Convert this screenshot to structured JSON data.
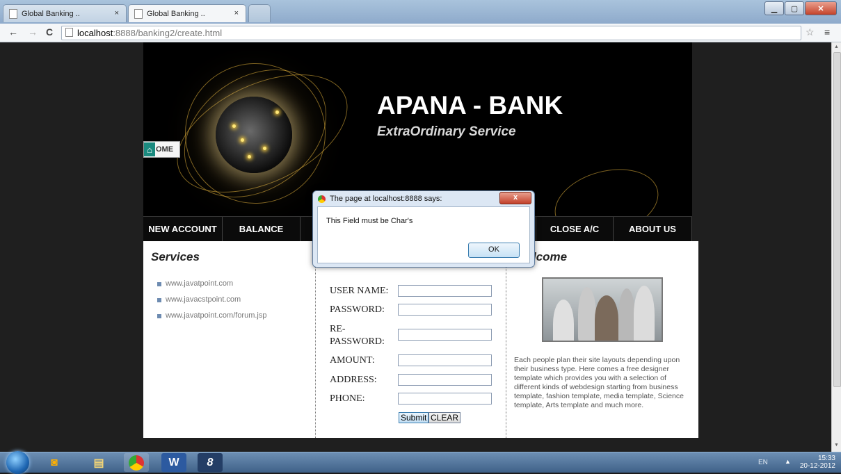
{
  "browser": {
    "tabs": [
      {
        "label": "Global Banking .."
      },
      {
        "label": "Global Banking .."
      }
    ],
    "close_glyph": "×",
    "url_host": "localhost",
    "url_path": ":8888/banking2/create.html",
    "icons": [
      "back-arrow-icon",
      "forward-arrow-icon",
      "reload-icon",
      "page-icon",
      "star-icon",
      "menu-icon"
    ]
  },
  "site": {
    "title": "APANA - BANK",
    "tagline": "ExtraOrdinary Service",
    "home_logo": "OME",
    "menu": [
      {
        "label": "NEW ACCOUNT"
      },
      {
        "label": "BALANCE"
      },
      {
        "label": "CLOSE A/C"
      },
      {
        "label": "ABOUT US"
      }
    ],
    "services": {
      "heading": "Services",
      "links": [
        "www.javatpoint.com",
        "www.javacstpoint.com",
        "www.javatpoint.com/forum.jsp"
      ]
    },
    "form": {
      "fields": [
        {
          "label": "USER NAME:",
          "value": ""
        },
        {
          "label": "PASSWORD:",
          "value": ""
        },
        {
          "label": "RE-PASSWORD:",
          "value": ""
        },
        {
          "label": "AMOUNT:",
          "value": ""
        },
        {
          "label": "ADDRESS:",
          "value": ""
        },
        {
          "label": "PHONE:",
          "value": ""
        }
      ],
      "submit_label": "Submit",
      "clear_label": "CLEAR"
    },
    "welcome": {
      "heading": "lcome",
      "text": "Each people plan their site layouts depending upon their business type. Here comes a free designer template which provides you with a selection of different kinds of webdesign starting from business template, fashion template, media template, Science template, Arts template and much more."
    }
  },
  "dialog": {
    "title": "The page at localhost:8888 says:",
    "message": "This Field must be Char's",
    "ok_label": "OK",
    "close_glyph": "x"
  },
  "taskbar": {
    "lang": "EN",
    "time": "15:33",
    "date": "20-12-2012",
    "icons": [
      "windows-start-icon",
      "media-player-icon",
      "file-explorer-icon",
      "chrome-icon",
      "word-icon",
      "app-s-icon"
    ]
  },
  "colors": {
    "accent": "#1b8a7f",
    "banner_bg": "#000000",
    "dialog_bg": "#dce7f4"
  }
}
